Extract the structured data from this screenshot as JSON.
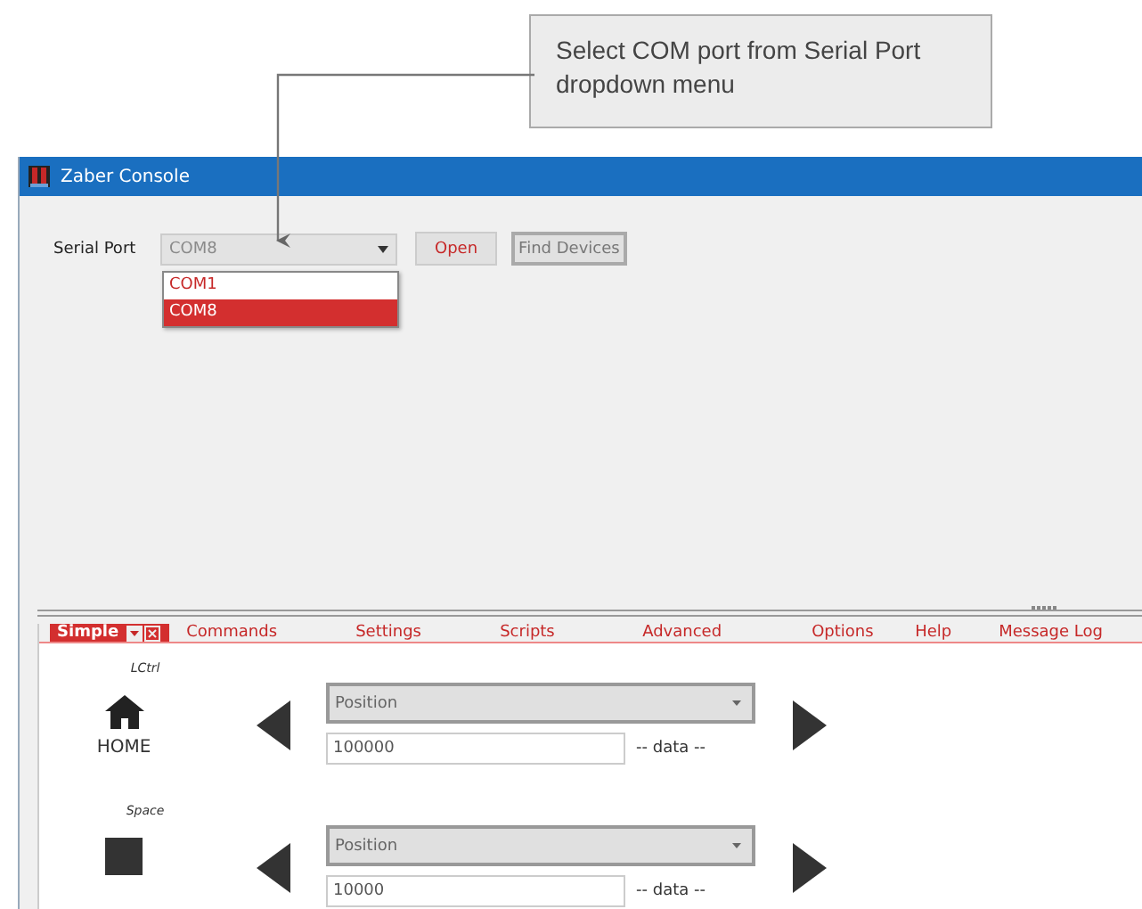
{
  "annotation": {
    "text": "Select COM port from Serial Port dropdown menu"
  },
  "window": {
    "title": "Zaber Console"
  },
  "serial_port": {
    "label": "Serial Port",
    "value": "COM8",
    "expanded": true,
    "options": [
      {
        "label": "COM1",
        "selected": false
      },
      {
        "label": "COM8",
        "selected": true
      }
    ]
  },
  "buttons": [
    {
      "label": "Open",
      "disabled": false
    },
    {
      "label": "Find Devices",
      "disabled": true
    }
  ],
  "tabs": [
    {
      "label": "Simple",
      "selected": true
    },
    {
      "label": "Commands",
      "selected": false
    },
    {
      "label": "Settings",
      "selected": false
    },
    {
      "label": "Scripts",
      "selected": false
    },
    {
      "label": "Advanced",
      "selected": false
    },
    {
      "label": "Options",
      "selected": false
    },
    {
      "label": "Help",
      "selected": false
    },
    {
      "label": "Message Log",
      "selected": false
    }
  ],
  "commands": [
    {
      "key": "LCtrl",
      "kind": "home",
      "label": "HOME",
      "field": "Position",
      "value": "100000",
      "data": "-- data --"
    },
    {
      "key": "Space",
      "kind": "stop",
      "field": "Position",
      "value": "10000",
      "data": "-- data --"
    }
  ]
}
